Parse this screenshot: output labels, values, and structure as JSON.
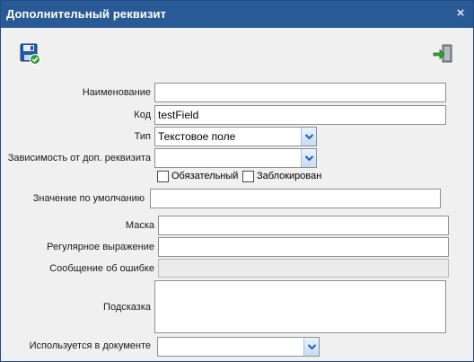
{
  "window": {
    "title": "Дополнительный реквизит",
    "close_symbol": "×"
  },
  "toolbar": {
    "save_icon": "save-floppy-icon",
    "exit_icon": "exit-door-icon"
  },
  "fields": {
    "name": {
      "label": "Наименование",
      "value": ""
    },
    "code": {
      "label": "Код",
      "value": "testField"
    },
    "type": {
      "label": "Тип",
      "value": "Текстовое поле"
    },
    "dependency": {
      "label": "Зависимость от доп. реквизита",
      "value": ""
    },
    "required": {
      "label": "Обязательный",
      "checked": false
    },
    "locked": {
      "label": "Заблокирован",
      "checked": false
    },
    "default_value": {
      "label": "Значение по умолчанию",
      "value": ""
    },
    "mask": {
      "label": "Маска",
      "value": ""
    },
    "regex": {
      "label": "Регулярное выражение",
      "value": ""
    },
    "error_message": {
      "label": "Сообщение об ошибке",
      "value": ""
    },
    "hint": {
      "label": "Подсказка",
      "value": ""
    },
    "used_in_document": {
      "label": "Используется в документе",
      "value": ""
    }
  },
  "colors": {
    "titlebar": "#2a5a96",
    "dropdown_arrow": "#1c5fb8",
    "save_icon_blue": "#2457a6",
    "check_green": "#2f9a37",
    "exit_green": "#3aa13a"
  }
}
